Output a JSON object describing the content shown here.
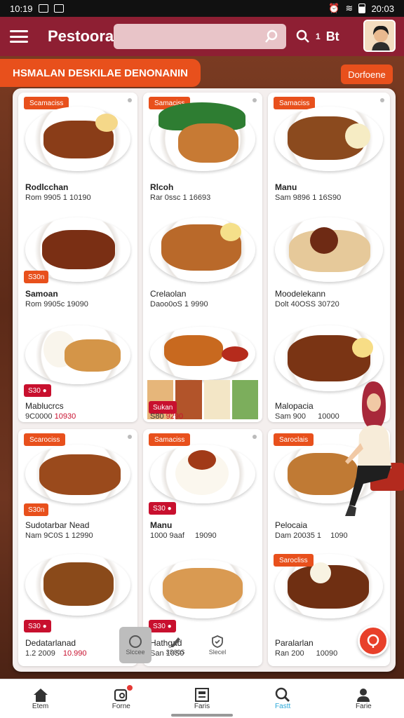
{
  "status_bar": {
    "time": "10:19",
    "right_time": "20:03"
  },
  "app": {
    "title": "Pestoora",
    "right_label": "Bt",
    "right_count": "1"
  },
  "search": {
    "placeholder": ""
  },
  "banner": {
    "text": "HSMALAN DESKILAE DENONANIN",
    "button": "Dorfoene"
  },
  "cards": [
    {
      "tag": "Scamaciss",
      "name": "Rodlcchan",
      "price": "Rom 9905 1 10190",
      "price_red": ""
    },
    {
      "tag": "Samaciss",
      "name": "Rlcoh",
      "price": "Rar 0ssc 1 16693",
      "price_red": ""
    },
    {
      "tag": "Samaciss",
      "name": "Manu",
      "price": "Sam 9896 1 16S90",
      "price_red": ""
    },
    {
      "tag": "",
      "rating": "S30n",
      "name": "Samoan",
      "price": "Rom 9905c 19090",
      "price_red": ""
    },
    {
      "tag": "",
      "name": "Crelaolan",
      "price": "Daoo0oS 1 9990",
      "price_red": ""
    },
    {
      "tag": "",
      "name": "Moodelekann",
      "price": "Dolt 40OSS 30720",
      "price_red": ""
    },
    {
      "tag": "",
      "rating": "S30 ●",
      "name": "Mablucrcs",
      "price": "9C0000",
      "price_red": "10930"
    },
    {
      "tag": "",
      "rating": "Sukan",
      "name": "",
      "price": "S80",
      "price_red": "9290"
    },
    {
      "tag": "",
      "name": "Malopacia",
      "price": "Sam 900",
      "price_red": "",
      "price_tail": "10000"
    },
    {
      "tag": "Scarociss",
      "rating": "S30n",
      "name": "Sudotarbar Nead",
      "price": "Nam 9C0S 1 12990",
      "price_red": ""
    },
    {
      "tag": "Samaciss",
      "rating": "S30 ●",
      "name": "Manu",
      "price": "1000 9aaf",
      "price_tail": "19090"
    },
    {
      "tag": "Saroclais",
      "name": "Pelocaia",
      "price": "Dam 20035 1",
      "price_tail": "1090"
    },
    {
      "tag": "",
      "rating": "S30 ●",
      "name": "Dedatarlanad",
      "price": "1.2 2009",
      "price_red": "10.990"
    },
    {
      "tag": "Samaciss",
      "rating": "S30 ●",
      "name": "Hathgad",
      "price": "San 10S0",
      "price_red": ""
    },
    {
      "tag": "Sarocliss",
      "name": "Paralarlan",
      "price": "Ran 200",
      "price_tail": "10090"
    }
  ],
  "float_toolbar": [
    {
      "icon": "circle-icon",
      "label": "Slccee"
    },
    {
      "icon": "pen-icon",
      "label": "3S00S"
    },
    {
      "icon": "shield-check-icon",
      "label": "Slecel"
    }
  ],
  "bottom_nav": [
    {
      "icon": "home-icon",
      "label": "Etem"
    },
    {
      "icon": "cart-icon",
      "label": "Forne"
    },
    {
      "icon": "form-icon",
      "label": "Faris"
    },
    {
      "icon": "search-icon",
      "label": "Fastt"
    },
    {
      "icon": "profile-icon",
      "label": "Farie"
    }
  ],
  "colors": {
    "appbar": "#8e1f33",
    "accent": "#e8501c",
    "price_red": "#c8102e",
    "active_nav": "#2aa7d8"
  }
}
